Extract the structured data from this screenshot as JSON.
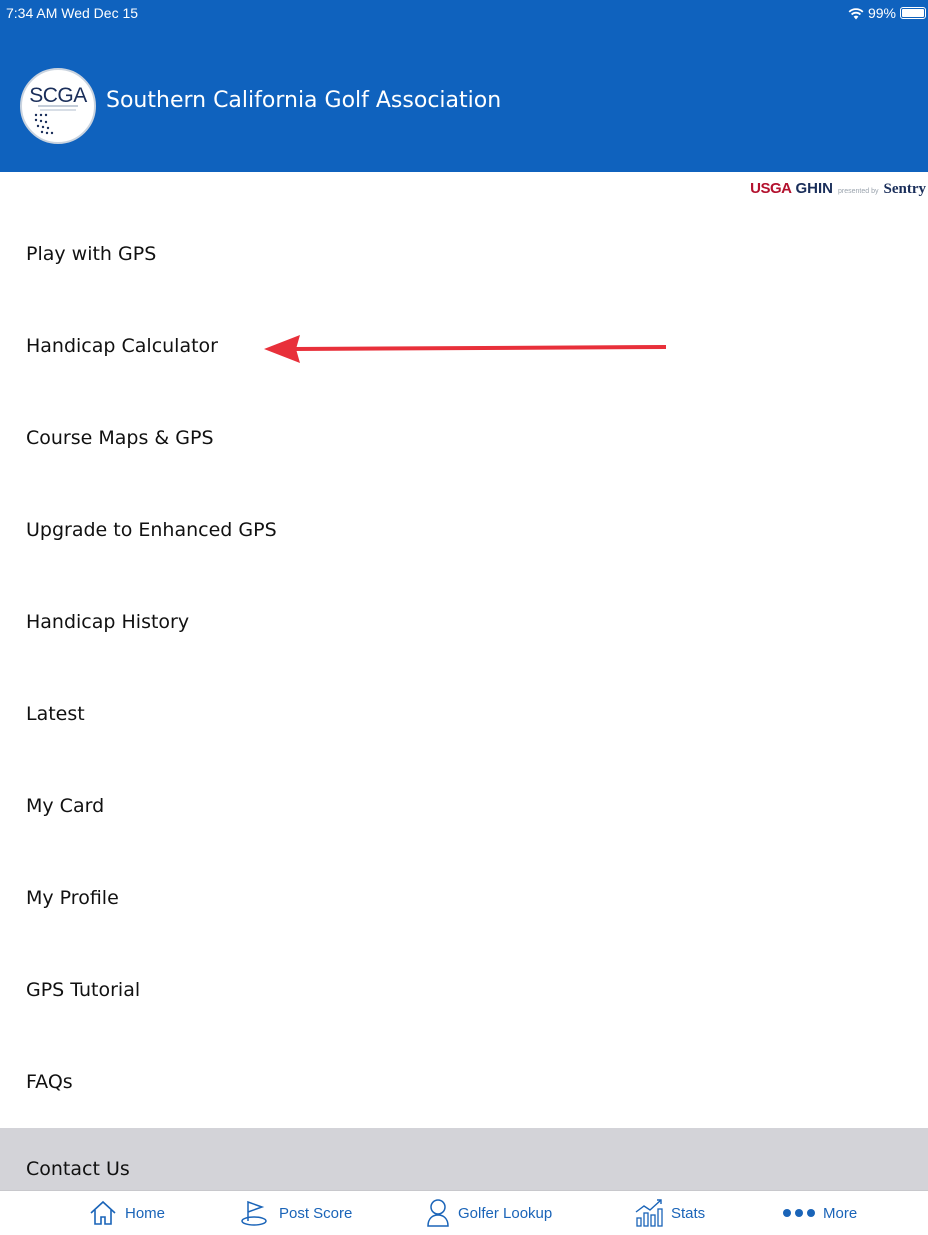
{
  "status_bar": {
    "time": "7:34 AM  Wed Dec 15",
    "battery": "99%",
    "wifi_icon": "wifi-icon",
    "battery_level": 0.99
  },
  "header": {
    "logo_text": "SCGA",
    "title": "Southern California Golf Association",
    "background": "#0f62be"
  },
  "powered_by": {
    "usga": "USGA",
    "ghin": "GHIN",
    "presented": "presented by",
    "sentry": "Sentry"
  },
  "menu": {
    "items": [
      {
        "label": "Play with GPS"
      },
      {
        "label": "Handicap Calculator"
      },
      {
        "label": "Course Maps & GPS"
      },
      {
        "label": "Upgrade to Enhanced GPS"
      },
      {
        "label": "Handicap History"
      },
      {
        "label": "Latest"
      },
      {
        "label": "My Card"
      },
      {
        "label": "My Profile"
      },
      {
        "label": "GPS Tutorial"
      },
      {
        "label": "FAQs"
      },
      {
        "label": "Contact Us",
        "selected": true
      }
    ]
  },
  "annotation": {
    "color": "#e8303a",
    "points_to": "Handicap Calculator"
  },
  "tabbar": {
    "accent": "#1a64b8",
    "tabs": [
      {
        "label": "Home",
        "icon": "home-icon"
      },
      {
        "label": "Post Score",
        "icon": "flag-icon"
      },
      {
        "label": "Golfer Lookup",
        "icon": "person-icon"
      },
      {
        "label": "Stats",
        "icon": "stats-icon"
      },
      {
        "label": "More",
        "icon": "more-dots-icon"
      }
    ]
  }
}
